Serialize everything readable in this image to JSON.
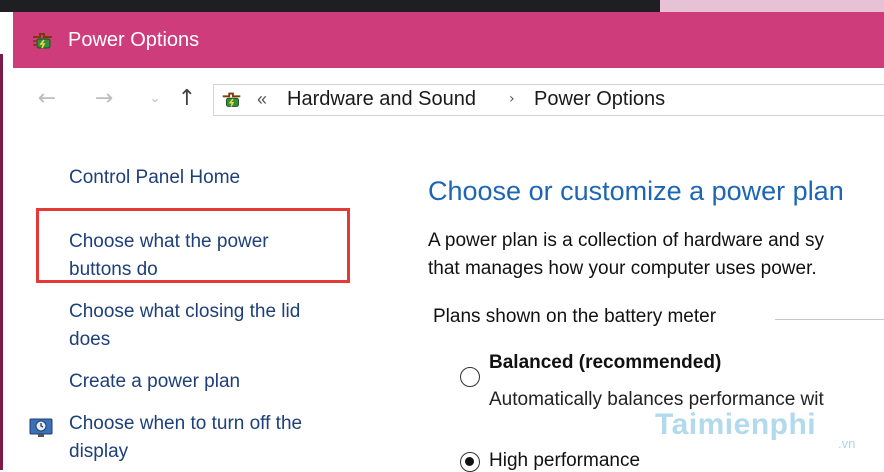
{
  "window": {
    "title": "Power Options"
  },
  "nav": {
    "back_icon": "arrow-left-icon",
    "forward_icon": "arrow-right-icon",
    "recent_icon": "chevron-down-icon",
    "up_icon": "arrow-up-icon"
  },
  "address_bar": {
    "overflow": "«",
    "breadcrumbs": [
      "Hardware and Sound",
      "Power Options"
    ],
    "separator": "›"
  },
  "sidebar": {
    "home": "Control Panel Home",
    "links": [
      {
        "line1": "Choose what the power",
        "line2": "buttons do"
      },
      {
        "line1": "Choose what closing the lid",
        "line2": "does"
      },
      {
        "line1": "Create a power plan"
      },
      {
        "line1": "Choose when to turn off the",
        "line2": "display"
      }
    ]
  },
  "main": {
    "title": "Choose or customize a power plan",
    "description_line1": "A power plan is a collection of hardware and sy",
    "description_line2": "that manages how your computer uses power.",
    "plans_label": "Plans shown on the battery meter",
    "plans": [
      {
        "name": "Balanced (recommended)",
        "description": "Automatically balances performance wit",
        "selected": false
      },
      {
        "name": "High performance",
        "selected": true
      }
    ]
  },
  "watermark": {
    "text": "Taimienphi",
    "suffix": ".vn"
  },
  "colors": {
    "titlebar": "#cf3c7c",
    "link": "#1d3f7a",
    "heading": "#1e66b4",
    "highlight": "#e53935"
  }
}
